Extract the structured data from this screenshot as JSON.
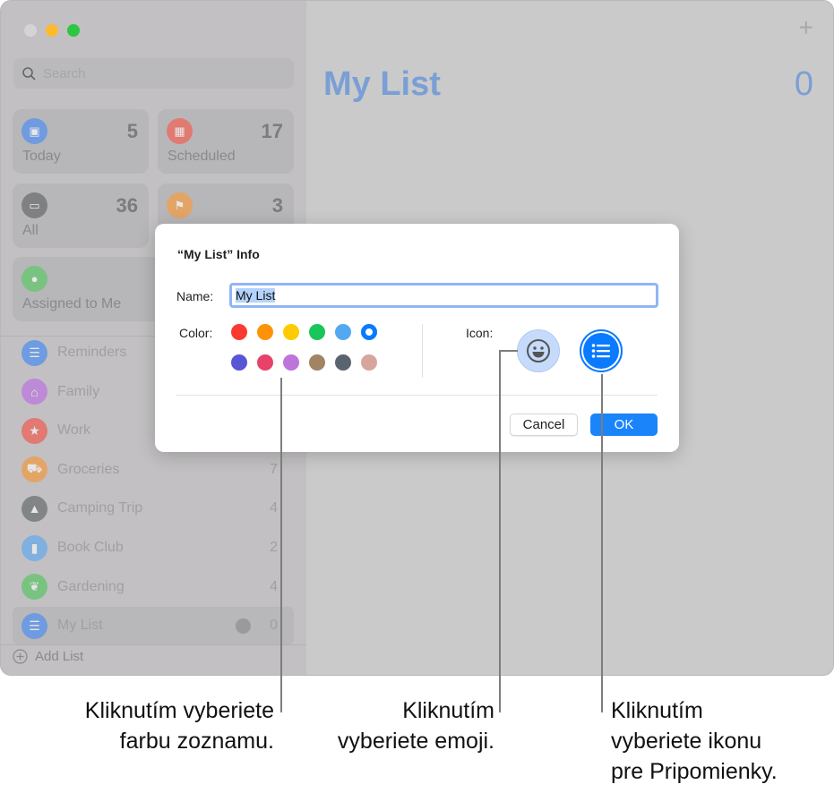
{
  "window": {
    "traffic_lights": [
      "close",
      "minimize",
      "zoom"
    ]
  },
  "sidebar": {
    "search_placeholder": "Search",
    "smart_lists": [
      {
        "label": "Today",
        "count": "5",
        "icon": "calendar-icon",
        "color": "#6f9be0"
      },
      {
        "label": "Scheduled",
        "count": "17",
        "icon": "calendar-grid-icon",
        "color": "#e07a72"
      },
      {
        "label": "All",
        "count": "36",
        "icon": "tray-icon",
        "color": "#7f8082"
      },
      {
        "label": "",
        "count": "3",
        "icon": "flag-icon",
        "color": "#e3a566"
      },
      {
        "label": "Assigned to Me",
        "count": "",
        "icon": "person-icon",
        "color": "#79c380"
      }
    ],
    "lists": [
      {
        "label": "Reminders",
        "count": "",
        "icon": "list-icon",
        "color": "#6f9be0"
      },
      {
        "label": "Family",
        "count": "",
        "icon": "house-icon",
        "color": "#bc8ad6"
      },
      {
        "label": "Work",
        "count": "",
        "icon": "star-icon",
        "color": "#e07a72"
      },
      {
        "label": "Groceries",
        "count": "7",
        "icon": "cart-icon",
        "color": "#e3a566"
      },
      {
        "label": "Camping Trip",
        "count": "4",
        "icon": "tent-icon",
        "color": "#818586"
      },
      {
        "label": "Book Club",
        "count": "2",
        "icon": "bookmark-icon",
        "color": "#7fb0df"
      },
      {
        "label": "Gardening",
        "count": "4",
        "icon": "leaf-icon",
        "color": "#79c380"
      },
      {
        "label": "My List",
        "count": "0",
        "icon": "list-icon",
        "color": "#6f9be0"
      }
    ],
    "add_list": "Add List"
  },
  "main": {
    "title": "My List",
    "count": "0"
  },
  "dialog": {
    "title": "“My List” Info",
    "name_label": "Name:",
    "name_value": "My List",
    "color_label": "Color:",
    "colors": [
      "#fa3a30",
      "#fd9207",
      "#fecb00",
      "#1ac559",
      "#53a9f1",
      "#0a7aff",
      "#5856d6",
      "#e8416a",
      "#bd74db",
      "#a08464",
      "#5a646e",
      "#d7a59c"
    ],
    "selected_color": "#0a7aff",
    "icon_label": "Icon:",
    "cancel": "Cancel",
    "ok": "OK",
    "accent": "#0a7aff"
  },
  "callouts": {
    "color": [
      "Kliknutím vyberiete",
      "farbu zoznamu."
    ],
    "emoji": [
      "Kliknutím",
      "vyberiete emoji."
    ],
    "icon": [
      "Kliknutím",
      "vyberiete ikonu",
      "pre Pripomienky."
    ]
  }
}
